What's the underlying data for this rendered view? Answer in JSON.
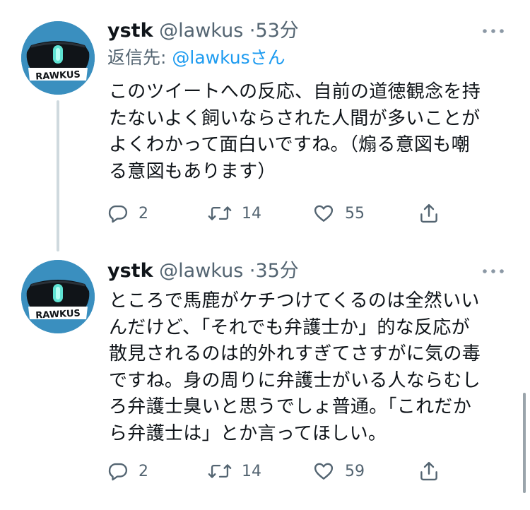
{
  "tweets": [
    {
      "name": "ystk",
      "handle": "@lawkus",
      "separator": "·",
      "time": "53分",
      "reply_to_prefix": "返信先: ",
      "reply_to_mention": "@lawkusさん",
      "lines": [
        "このツイートへの反応、自前の道徳観念を持",
        "たないよく飼いならされた人間が多いことが",
        "よくわかって面白いですね。（煽る意図も嘲",
        "る意図もあります）"
      ],
      "reply_count": "2",
      "retweet_count": "14",
      "like_count": "55",
      "avatar_label": "RAWKUS"
    },
    {
      "name": "ystk",
      "handle": "@lawkus",
      "separator": "·",
      "time": "35分",
      "lines": [
        "ところで馬鹿がケチつけてくるのは全然いい",
        "んだけど、「それでも弁護士か」的な反応が",
        "散見されるのは的外れすぎてさすがに気の毒",
        "ですね。身の周りに弁護士がいる人ならむし",
        "ろ弁護士臭いと思うでしょ普通。「これだか",
        "ら弁護士は」とか言ってほしい。"
      ],
      "reply_count": "2",
      "retweet_count": "14",
      "like_count": "59",
      "avatar_label": "RAWKUS"
    }
  ],
  "icons": {
    "reply": "reply-icon",
    "retweet": "retweet-icon",
    "like": "heart-icon",
    "share": "share-icon",
    "more": "more-icon"
  },
  "colors": {
    "text": "#0f1419",
    "secondary": "#536471",
    "accent": "#1d9bf0",
    "avatar_bg": "#3a8fbf",
    "thread_line": "#cfd9de"
  }
}
